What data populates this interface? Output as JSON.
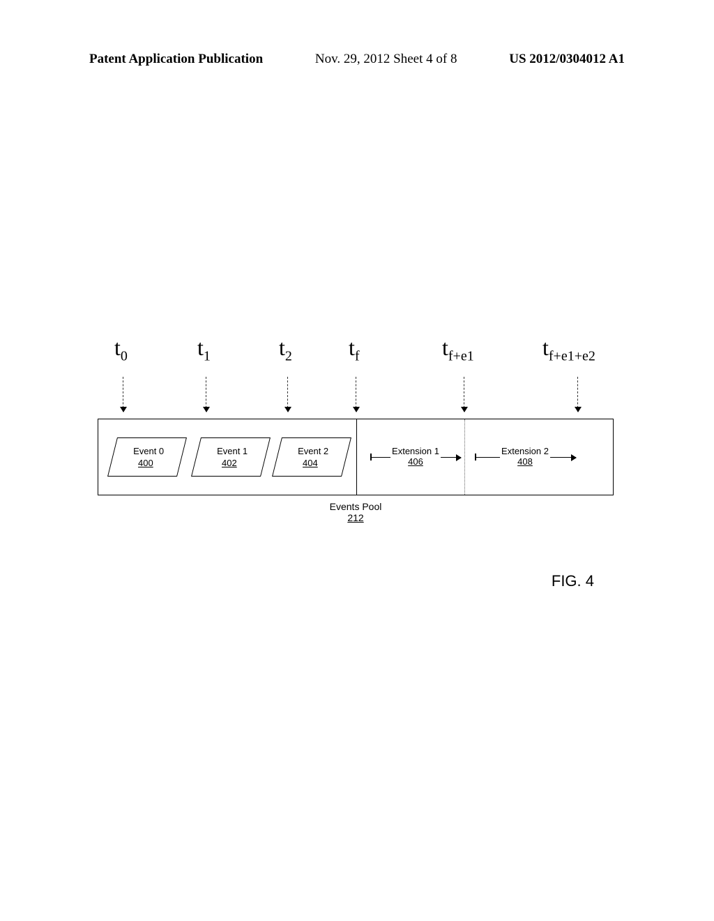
{
  "header": {
    "left": "Patent Application Publication",
    "center": "Nov. 29, 2012  Sheet 4 of 8",
    "right": "US 2012/0304012 A1"
  },
  "time_labels": {
    "t0": "t",
    "t0_sub": "0",
    "t1": "t",
    "t1_sub": "1",
    "t2": "t",
    "t2_sub": "2",
    "tf": "t",
    "tf_sub": "f",
    "tfe1": "t",
    "tfe1_sub": "f+e1",
    "tfe1e2": "t",
    "tfe1e2_sub": "f+e1+e2"
  },
  "events": {
    "e0": {
      "label": "Event 0",
      "num": "400"
    },
    "e1": {
      "label": "Event 1",
      "num": "402"
    },
    "e2": {
      "label": "Event 2",
      "num": "404"
    }
  },
  "extensions": {
    "x1": {
      "label": "Extension 1",
      "num": "406"
    },
    "x2": {
      "label": "Extension 2",
      "num": "408"
    }
  },
  "pool": {
    "label": "Events Pool",
    "num": "212"
  },
  "fig_label": "FIG. 4",
  "positions": {
    "t0": 36,
    "t1": 155,
    "t2": 272,
    "tf": 370,
    "tfe1": 525,
    "tfe1e2": 688,
    "event_w": 100
  }
}
